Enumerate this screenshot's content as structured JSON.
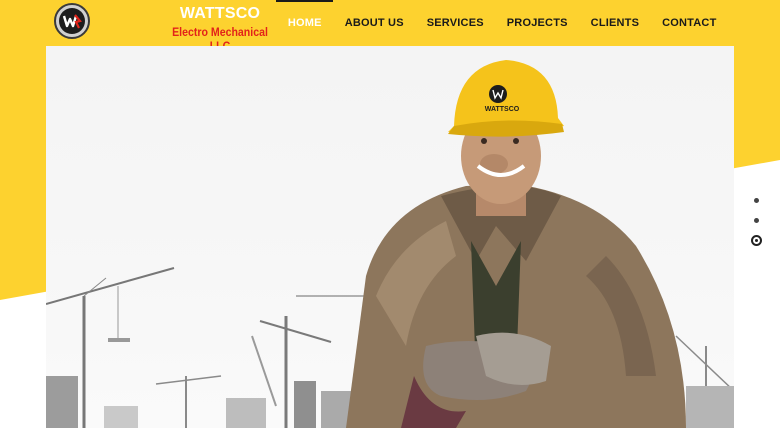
{
  "brand": {
    "name": "WATTSCO",
    "subtitle": "Electro Mechanical LLC"
  },
  "nav": {
    "items": [
      {
        "label": "HOME",
        "active": true
      },
      {
        "label": "ABOUT US",
        "active": false
      },
      {
        "label": "SERVICES",
        "active": false
      },
      {
        "label": "PROJECTS",
        "active": false
      },
      {
        "label": "CLIENTS",
        "active": false
      },
      {
        "label": "CONTACT",
        "active": false
      }
    ]
  },
  "hero": {
    "helmet_text": "WATTSCO",
    "image_subject": "worker"
  },
  "slider": {
    "slide_count": 3,
    "active_index": 2
  },
  "colors": {
    "accent": "#fdd22f",
    "brand_red": "#e2231a",
    "nav_text": "#1a1a1a"
  }
}
